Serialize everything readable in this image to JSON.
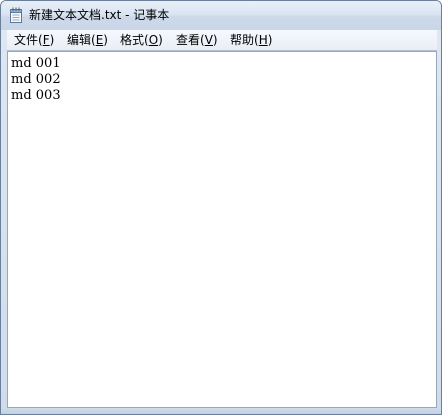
{
  "window": {
    "title": "新建文本文档.txt - 记事本",
    "app_icon": "notepad-icon"
  },
  "menu": {
    "items": [
      {
        "label": "文件(",
        "accel": "F",
        "suffix": ")"
      },
      {
        "label": "编辑(",
        "accel": "E",
        "suffix": ")"
      },
      {
        "label": "格式(",
        "accel": "O",
        "suffix": ")"
      },
      {
        "label": "查看(",
        "accel": "V",
        "suffix": ")"
      },
      {
        "label": "帮助(",
        "accel": "H",
        "suffix": ")"
      }
    ]
  },
  "editor": {
    "lines": [
      "md 001",
      "md 002",
      "md 003"
    ]
  },
  "colors": {
    "titlebar": "#dbe5f2",
    "menubar": "#f0f4f9",
    "editor_bg": "#ffffff"
  }
}
